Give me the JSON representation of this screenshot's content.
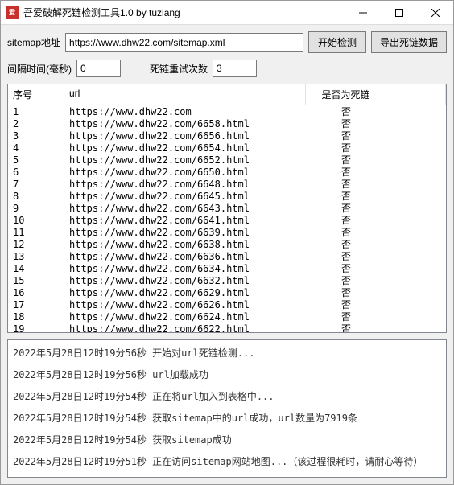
{
  "titlebar": {
    "title": "吾爱破解死链检测工具1.0 by tuziang"
  },
  "labels": {
    "sitemap": "sitemap地址",
    "interval": "间隔时间(毫秒)",
    "retry": "死链重试次数"
  },
  "inputs": {
    "sitemap_url": "https://www.dhw22.com/sitemap.xml",
    "interval": "0",
    "retry": "3"
  },
  "buttons": {
    "start": "开始检测",
    "export": "导出死链数据"
  },
  "table": {
    "headers": {
      "idx": "序号",
      "url": "url",
      "dead": "是否为死链"
    },
    "rows": [
      {
        "idx": "1",
        "url": "https://www.dhw22.com",
        "dead": "否"
      },
      {
        "idx": "2",
        "url": "https://www.dhw22.com/6658.html",
        "dead": "否"
      },
      {
        "idx": "3",
        "url": "https://www.dhw22.com/6656.html",
        "dead": "否"
      },
      {
        "idx": "4",
        "url": "https://www.dhw22.com/6654.html",
        "dead": "否"
      },
      {
        "idx": "5",
        "url": "https://www.dhw22.com/6652.html",
        "dead": "否"
      },
      {
        "idx": "6",
        "url": "https://www.dhw22.com/6650.html",
        "dead": "否"
      },
      {
        "idx": "7",
        "url": "https://www.dhw22.com/6648.html",
        "dead": "否"
      },
      {
        "idx": "8",
        "url": "https://www.dhw22.com/6645.html",
        "dead": "否"
      },
      {
        "idx": "9",
        "url": "https://www.dhw22.com/6643.html",
        "dead": "否"
      },
      {
        "idx": "10",
        "url": "https://www.dhw22.com/6641.html",
        "dead": "否"
      },
      {
        "idx": "11",
        "url": "https://www.dhw22.com/6639.html",
        "dead": "否"
      },
      {
        "idx": "12",
        "url": "https://www.dhw22.com/6638.html",
        "dead": "否"
      },
      {
        "idx": "13",
        "url": "https://www.dhw22.com/6636.html",
        "dead": "否"
      },
      {
        "idx": "14",
        "url": "https://www.dhw22.com/6634.html",
        "dead": "否"
      },
      {
        "idx": "15",
        "url": "https://www.dhw22.com/6632.html",
        "dead": "否"
      },
      {
        "idx": "16",
        "url": "https://www.dhw22.com/6629.html",
        "dead": "否"
      },
      {
        "idx": "17",
        "url": "https://www.dhw22.com/6626.html",
        "dead": "否"
      },
      {
        "idx": "18",
        "url": "https://www.dhw22.com/6624.html",
        "dead": "否"
      },
      {
        "idx": "19",
        "url": "https://www.dhw22.com/6622.html",
        "dead": "否"
      }
    ]
  },
  "log": [
    "2022年5月28日12时19分56秒   开始对url死链检测...",
    "2022年5月28日12时19分56秒   url加载成功",
    "2022年5月28日12时19分54秒   正在将url加入到表格中...",
    "2022年5月28日12时19分54秒   获取sitemap中的url成功，url数量为7919条",
    "2022年5月28日12时19分54秒   获取sitemap成功",
    "2022年5月28日12时19分51秒   正在访问sitemap网站地图...（该过程很耗时，请耐心等待）"
  ]
}
